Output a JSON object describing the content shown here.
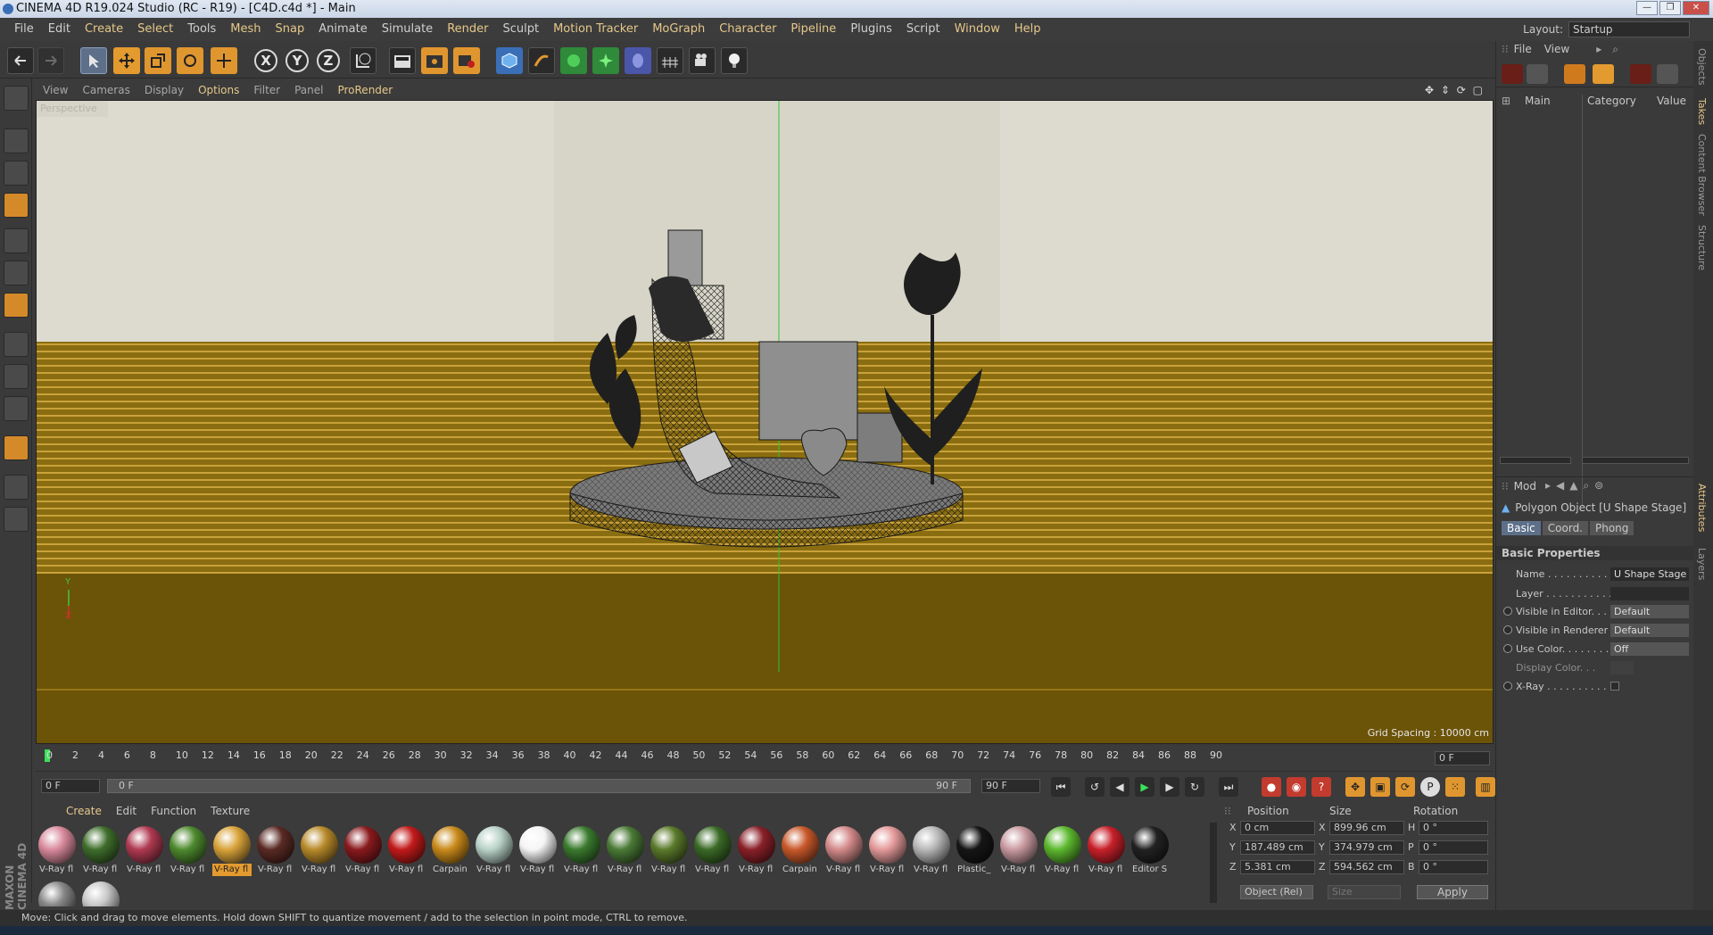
{
  "window": {
    "title": "CINEMA 4D R19.024 Studio (RC - R19) - [C4D.c4d *] - Main",
    "buttons": [
      "—",
      "❐",
      "✕"
    ]
  },
  "menu": [
    "File",
    "Edit",
    "Create",
    "Select",
    "Tools",
    "Mesh",
    "Snap",
    "Animate",
    "Simulate",
    "Render",
    "Sculpt",
    "Motion Tracker",
    "MoGraph",
    "Character",
    "Pipeline",
    "Plugins",
    "Script",
    "Window",
    "Help"
  ],
  "layout": {
    "label": "Layout:",
    "value": "Startup"
  },
  "toolbar": {
    "axis_x": "X",
    "axis_y": "Y",
    "axis_z": "Z"
  },
  "viewport": {
    "menu": [
      "View",
      "Cameras",
      "Display",
      "Options",
      "Filter",
      "Panel",
      "ProRender"
    ],
    "icons": "✥ ⇕ ⟳ ▢",
    "label": "Perspective",
    "grid_spacing": "Grid Spacing : 10000 cm",
    "axis_y": "Y",
    "axis_x": "X"
  },
  "objects_panel": {
    "menu": [
      "File",
      "View"
    ],
    "columns": [
      "Main",
      "Category",
      "Value"
    ]
  },
  "attributes": {
    "mode_label": "Mod",
    "object_title": "Polygon Object [U Shape Stage]",
    "tabs": [
      "Basic",
      "Coord.",
      "Phong"
    ],
    "section": "Basic Properties",
    "fields": [
      {
        "label": "Name . . . . . . . . . . .",
        "value": "U Shape Stage"
      },
      {
        "label": "Layer . . . . . . . . . . .",
        "value": ""
      },
      {
        "label": "Visible in Editor. . .",
        "value": "Default"
      },
      {
        "label": "Visible in Renderer",
        "value": "Default"
      },
      {
        "label": "Use Color. . . . . . . .",
        "value": "Off"
      },
      {
        "label": "Display Color. . .",
        "value": ""
      },
      {
        "label": "X-Ray . . . . . . . . . .",
        "value": ""
      }
    ]
  },
  "side_tabs": [
    "Objects",
    "Takes",
    "Content Browser",
    "Structure",
    "Attributes",
    "Layers"
  ],
  "timeline": {
    "ticks": [
      "0",
      "2",
      "4",
      "6",
      "8",
      "10",
      "12",
      "14",
      "16",
      "18",
      "20",
      "22",
      "24",
      "26",
      "28",
      "30",
      "32",
      "34",
      "36",
      "38",
      "40",
      "42",
      "44",
      "46",
      "48",
      "50",
      "52",
      "54",
      "56",
      "58",
      "60",
      "62",
      "64",
      "66",
      "68",
      "70",
      "72",
      "74",
      "76",
      "78",
      "80",
      "82",
      "84",
      "86",
      "88",
      "90"
    ],
    "current": "0 F",
    "start": "0 F",
    "slider_start": "0 F",
    "slider_end": "90 F",
    "end": "90 F"
  },
  "materials": {
    "menu": [
      "Create",
      "Edit",
      "Function",
      "Texture"
    ],
    "items": [
      {
        "label": "V-Ray fl",
        "color": "#d98a9c"
      },
      {
        "label": "V-Ray fl",
        "color": "#3f6e2c"
      },
      {
        "label": "V-Ray fl",
        "color": "#b03a52"
      },
      {
        "label": "V-Ray fl",
        "color": "#4e8a2e"
      },
      {
        "label": "V-Ray fl",
        "color": "#d9a33a"
      },
      {
        "label": "V-Ray fl",
        "color": "#5a2a24"
      },
      {
        "label": "V-Ray fl",
        "color": "#b88a2a"
      },
      {
        "label": "V-Ray fl",
        "color": "#8a1a1e"
      },
      {
        "label": "V-Ray fl",
        "color": "#c21a1a"
      },
      {
        "label": "Carpain",
        "color": "#c98a1a"
      },
      {
        "label": "V-Ray fl",
        "color": "#b9d2c8"
      },
      {
        "label": "V-Ray fl",
        "color": "#f5f5f5"
      },
      {
        "label": "V-Ray fl",
        "color": "#3a7a2e"
      },
      {
        "label": "V-Ray fl",
        "color": "#4a7a36"
      },
      {
        "label": "V-Ray fl",
        "color": "#5a7a2a"
      },
      {
        "label": "V-Ray fl",
        "color": "#3a6a26"
      },
      {
        "label": "V-Ray fl",
        "color": "#8a2028"
      },
      {
        "label": "Carpain",
        "color": "#c8582a"
      },
      {
        "label": "V-Ray fl",
        "color": "#d48a8a"
      },
      {
        "label": "V-Ray fl",
        "color": "#e49a9a"
      },
      {
        "label": "V-Ray fl",
        "color": "#b8b8b8"
      },
      {
        "label": "Plastic_",
        "color": "#161616"
      },
      {
        "label": "V-Ray fl",
        "color": "#c99aa0"
      },
      {
        "label": "V-Ray fl",
        "color": "#5cb82e"
      },
      {
        "label": "V-Ray fl",
        "color": "#c8202a"
      },
      {
        "label": "Editor S",
        "color": "#222222"
      }
    ],
    "active_index": 4,
    "row2": [
      {
        "color": "#888888"
      },
      {
        "color": "#c8c8c8"
      }
    ]
  },
  "coords": {
    "headers": [
      "Position",
      "Size",
      "Rotation"
    ],
    "rows": [
      {
        "axis": "X",
        "pos": "0 cm",
        "saxis": "X",
        "size": "899.96 cm",
        "raxis": "H",
        "rot": "0 °"
      },
      {
        "axis": "Y",
        "pos": "187.489 cm",
        "saxis": "Y",
        "size": "374.979 cm",
        "raxis": "P",
        "rot": "0 °"
      },
      {
        "axis": "Z",
        "pos": "5.381 cm",
        "saxis": "Z",
        "size": "594.562 cm",
        "raxis": "B",
        "rot": "0 °"
      }
    ],
    "mode": "Object (Rel)",
    "size_mode": "Size",
    "apply": "Apply"
  },
  "status": "Move: Click and drag to move elements. Hold down SHIFT to quantize movement / add to the selection in point mode, CTRL to remove.",
  "logo": "MAXON CINEMA 4D"
}
